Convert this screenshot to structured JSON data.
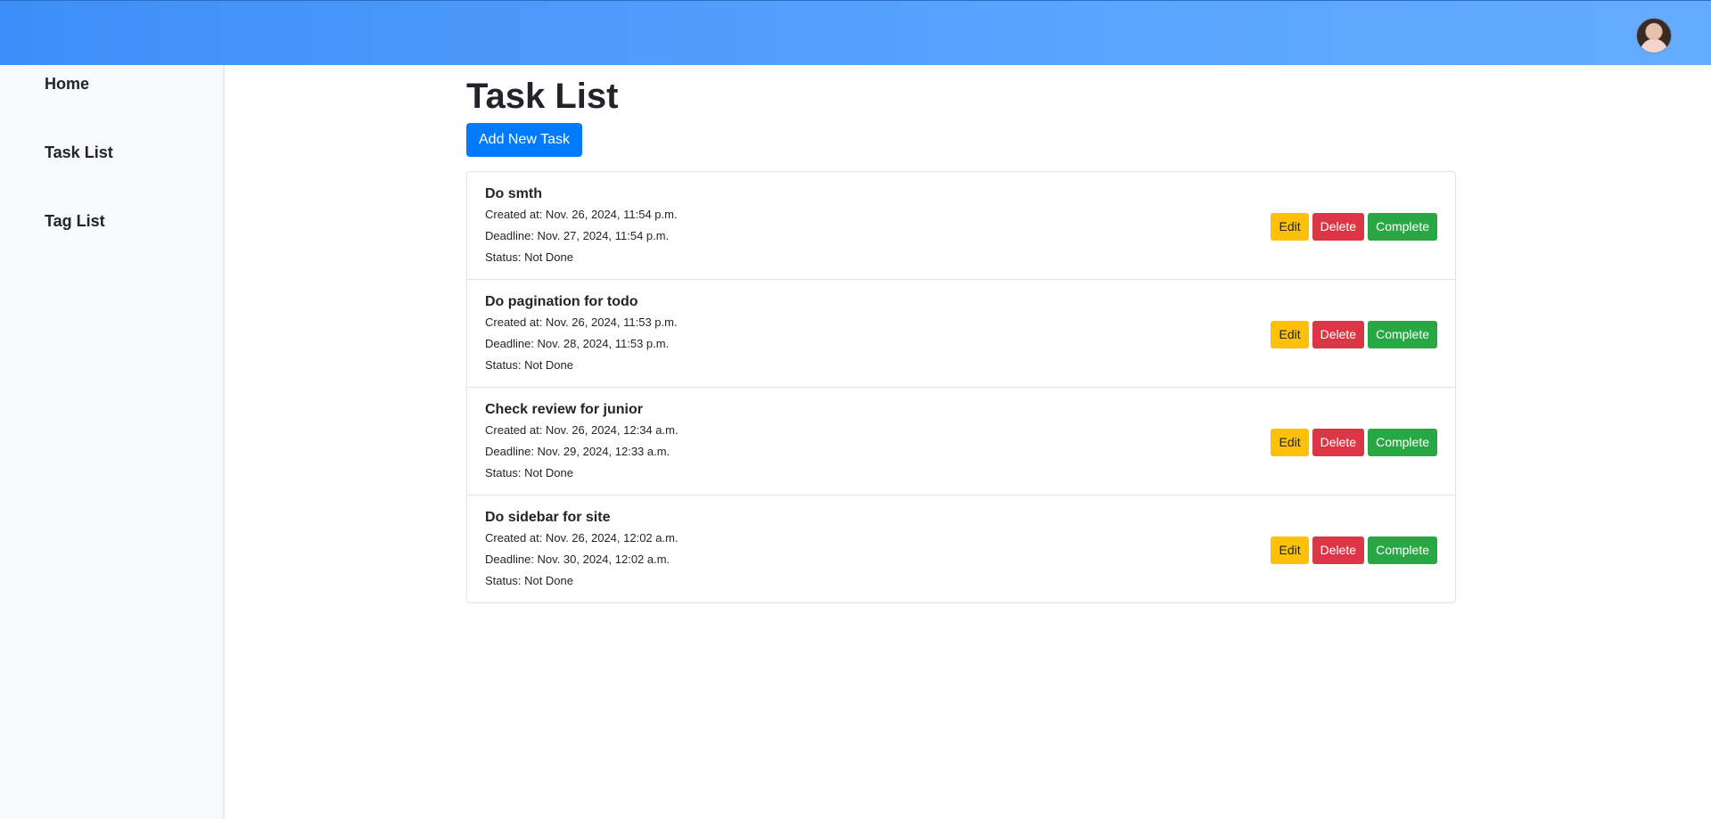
{
  "header": {
    "avatar_icon": "user-avatar",
    "accent_color": "#4d9cfb"
  },
  "sidebar": {
    "items": [
      {
        "label": "Home"
      },
      {
        "label": "Task List"
      },
      {
        "label": "Tag List"
      }
    ]
  },
  "main": {
    "title": "Task List",
    "add_button_label": "Add New Task",
    "tasks": [
      {
        "title": "Do smth",
        "created": "Created at: Nov. 26, 2024, 11:54 p.m.",
        "deadline": "Deadline: Nov. 27, 2024, 11:54 p.m.",
        "status": "Status: Not Done"
      },
      {
        "title": "Do pagination for todo",
        "created": "Created at: Nov. 26, 2024, 11:53 p.m.",
        "deadline": "Deadline: Nov. 28, 2024, 11:53 p.m.",
        "status": "Status: Not Done"
      },
      {
        "title": "Check review for junior",
        "created": "Created at: Nov. 26, 2024, 12:34 a.m.",
        "deadline": "Deadline: Nov. 29, 2024, 12:33 a.m.",
        "status": "Status: Not Done"
      },
      {
        "title": "Do sidebar for site",
        "created": "Created at: Nov. 26, 2024, 12:02 a.m.",
        "deadline": "Deadline: Nov. 30, 2024, 12:02 a.m.",
        "status": "Status: Not Done"
      }
    ],
    "actions": {
      "edit": "Edit",
      "delete": "Delete",
      "complete": "Complete"
    }
  },
  "colors": {
    "edit": "#ffc107",
    "delete": "#dc3545",
    "complete": "#28a745",
    "primary": "#007bff"
  }
}
